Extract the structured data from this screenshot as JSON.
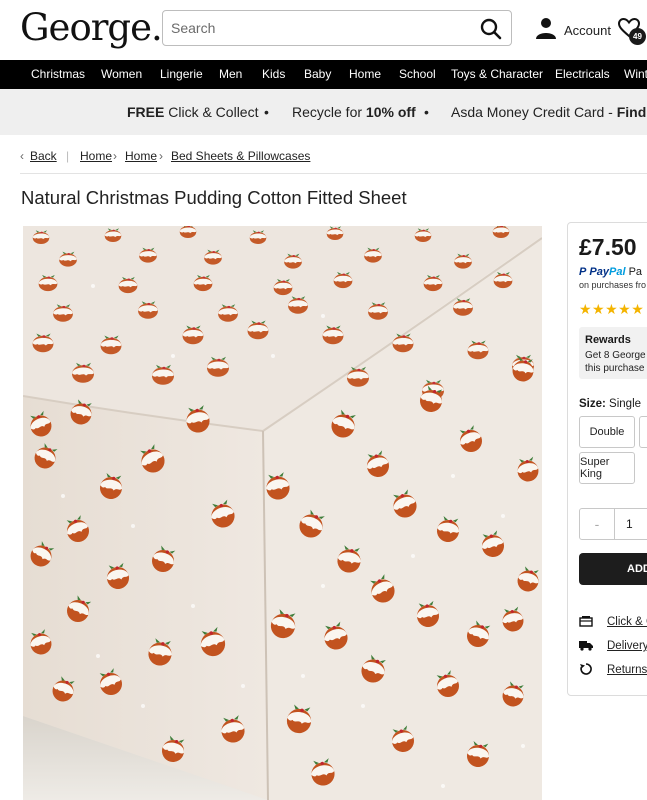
{
  "header": {
    "logo": "George.",
    "search_placeholder": "Search",
    "account_label": "Account",
    "wishlist_count": "49"
  },
  "nav": {
    "items": [
      "Christmas",
      "Women",
      "Lingerie",
      "Men",
      "Kids",
      "Baby",
      "Home",
      "School",
      "Toys & Character",
      "Electricals",
      "Wint"
    ]
  },
  "promo": {
    "items": [
      {
        "bold": "FREE",
        "text": " Click & Collect"
      },
      {
        "text": "Recycle for ",
        "bold": "10% off"
      },
      {
        "text": "Asda Money Credit Card - ",
        "bold": "Find out"
      }
    ]
  },
  "breadcrumb": {
    "back": "Back",
    "items": [
      "Home",
      "Home",
      "Bed Sheets & Pillowcases"
    ]
  },
  "product": {
    "title": "Natural Christmas Pudding Cotton Fitted Sheet",
    "price": "£7.50",
    "paypal_brand_1": "Pay",
    "paypal_brand_2": "Pal",
    "paypal_suffix": "Pa",
    "paypal_subtext": "on purchases fro",
    "stars": "★★★★★",
    "rewards_title": "Rewards",
    "rewards_line1_prefix": "Get ",
    "rewards_line1_bold": "8 George",
    "rewards_line2": "this purchase",
    "size_label": "Size:",
    "size_value": "Single",
    "sizes": [
      "Double",
      "Super King"
    ],
    "quantity": "1",
    "qty_minus": "-",
    "add_label": "ADD",
    "links": [
      "Click & C",
      "Delivery",
      "Returns"
    ]
  },
  "colors": {
    "nav_bg": "#000000",
    "promo_bg": "#efefef",
    "sheet_bg": "#ece5de",
    "pudding": "#c2531f",
    "star": "#f4b400",
    "paypal_dark": "#003087",
    "paypal_light": "#009cde"
  }
}
